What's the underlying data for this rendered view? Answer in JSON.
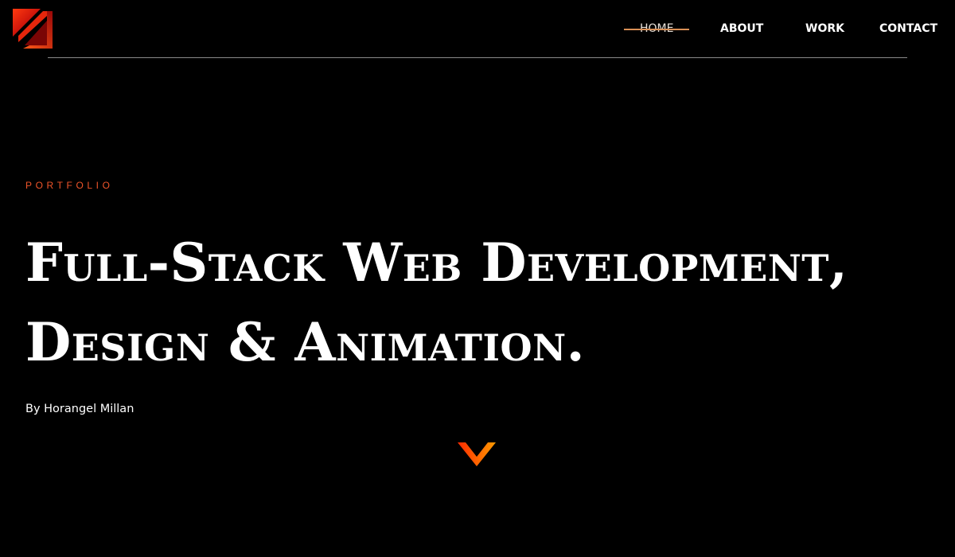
{
  "header": {
    "logo_icon": "gradient-square-slash-logo-icon",
    "nav": {
      "home": "HOME",
      "about": "ABOUT",
      "work": "WORK",
      "contact": "CONTACT"
    },
    "active_item": "home"
  },
  "hero": {
    "eyebrow": "PORTFOLIO",
    "headline_line1": "Full-Stack Web Development,",
    "headline_line2": "Design & Animation.",
    "byline": "By Horangel Millan",
    "scroll_icon": "chevron-down-icon"
  },
  "colors": {
    "background": "#000000",
    "accent_orange": "#f0552a",
    "gradient_start": "#ff2a00",
    "gradient_end": "#ff9b00",
    "nav_underline": "#d98f55",
    "rule": "#8a8a8a"
  }
}
